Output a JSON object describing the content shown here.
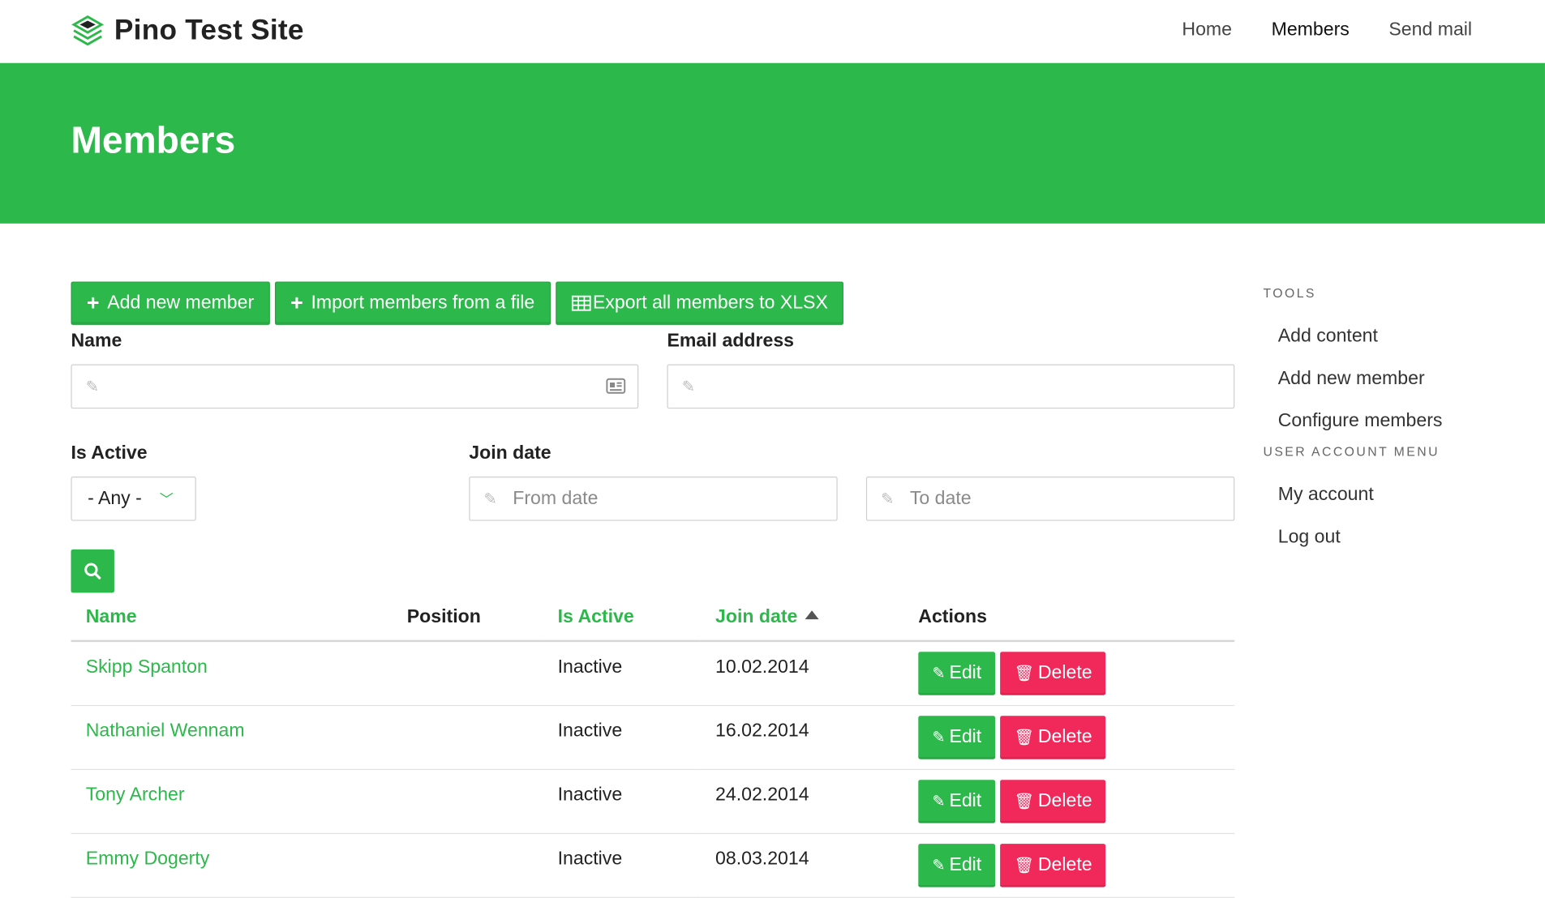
{
  "site": {
    "name": "Pino Test Site"
  },
  "nav": [
    {
      "label": "Home",
      "active": false
    },
    {
      "label": "Members",
      "active": true
    },
    {
      "label": "Send mail",
      "active": false
    }
  ],
  "page": {
    "title": "Members"
  },
  "actions": {
    "add_member": "Add new member",
    "import": "Import members from a file",
    "export": "Export all members to XLSX"
  },
  "filters": {
    "name_label": "Name",
    "email_label": "Email address",
    "active_label": "Is Active",
    "active_value": "- Any -",
    "join_label": "Join date",
    "from_placeholder": "From date",
    "to_placeholder": "To date"
  },
  "table": {
    "headers": [
      "Name",
      "Position",
      "Is Active",
      "Join date",
      "Actions"
    ],
    "rows": [
      {
        "name": "Skipp Spanton",
        "position": "",
        "active": "Inactive",
        "join": "10.02.2014"
      },
      {
        "name": "Nathaniel Wennam",
        "position": "",
        "active": "Inactive",
        "join": "16.02.2014"
      },
      {
        "name": "Tony Archer",
        "position": "",
        "active": "Inactive",
        "join": "24.02.2014"
      },
      {
        "name": "Emmy Dogerty",
        "position": "",
        "active": "Inactive",
        "join": "08.03.2014"
      }
    ],
    "edit_label": "Edit",
    "delete_label": "Delete"
  },
  "sidebar": {
    "tools_title": "Tools",
    "tools": [
      "Add content",
      "Add new member",
      "Configure members"
    ],
    "account_title": "User account menu",
    "account": [
      "My account",
      "Log out"
    ]
  },
  "colors": {
    "accent": "#2db84b",
    "danger": "#f0295a"
  }
}
